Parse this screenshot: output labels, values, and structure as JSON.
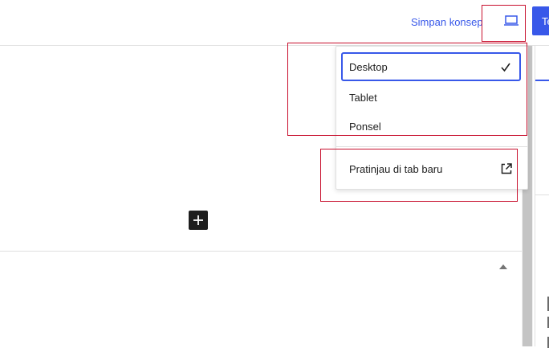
{
  "header": {
    "save_draft_label": "Simpan konsep",
    "publish_label": "Terbitkan"
  },
  "preview_menu": {
    "devices": [
      {
        "label": "Desktop",
        "selected": true
      },
      {
        "label": "Tablet",
        "selected": false
      },
      {
        "label": "Ponsel",
        "selected": false
      }
    ],
    "open_in_new_tab_label": "Pratinjau di tab baru"
  },
  "icons": {
    "preview": "laptop-icon",
    "check": "check-icon",
    "external": "external-link-icon",
    "add_block": "plus-icon",
    "collapse": "triangle-up-icon"
  },
  "colors": {
    "accent": "#3858e9",
    "annotation": "#c8102e",
    "add_block_bg": "#1e1e1e"
  }
}
